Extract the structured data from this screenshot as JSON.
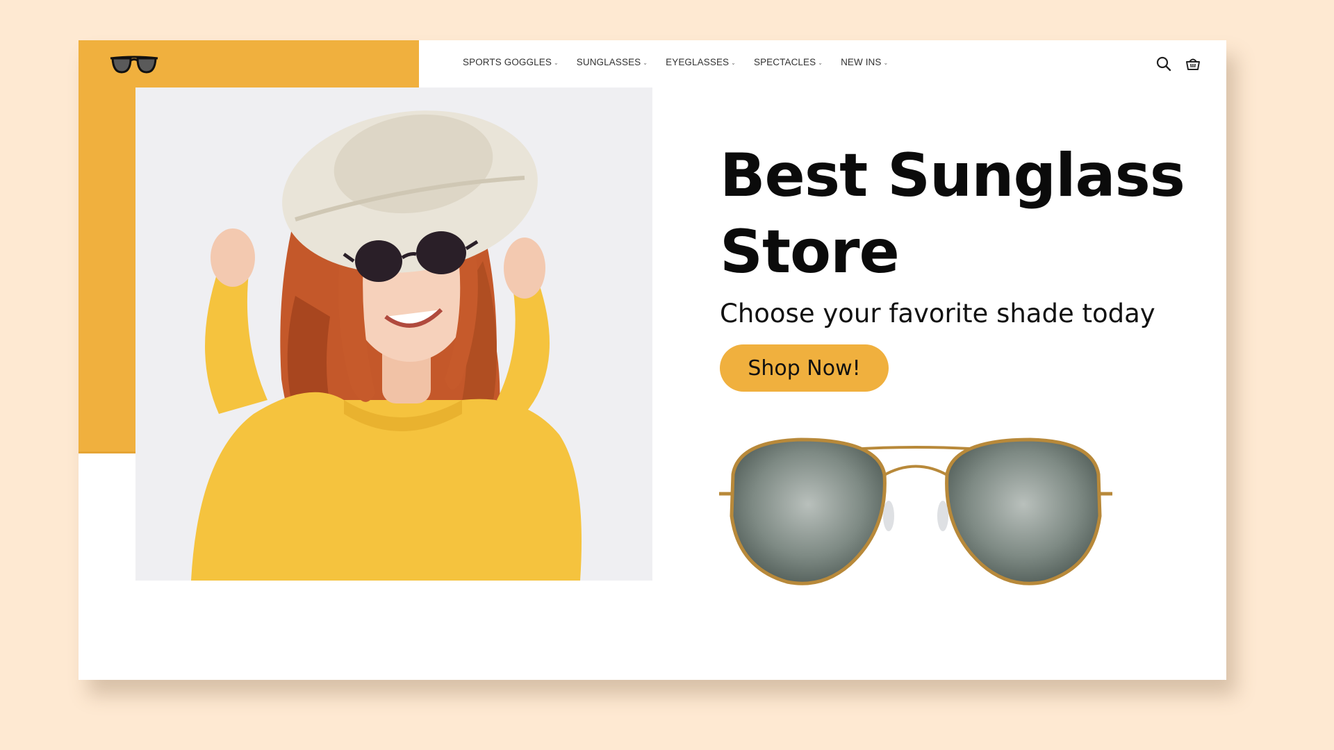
{
  "nav": {
    "items": [
      {
        "label": "SPORTS GOGGLES"
      },
      {
        "label": "SUNGLASSES"
      },
      {
        "label": "EYEGLASSES"
      },
      {
        "label": "SPECTACLES"
      },
      {
        "label": "NEW INS"
      }
    ],
    "caret": "⌄"
  },
  "hero": {
    "headline": "Best Sunglass Store",
    "subheadline": "Choose your favorite shade today",
    "cta_label": "Shop Now!"
  },
  "colors": {
    "page_bg": "#FEE9D2",
    "accent": "#F0B03E",
    "card_bg": "#FFFFFF",
    "text": "#0B0B0B"
  },
  "icons": [
    "sunglasses-logo-icon",
    "search-icon",
    "basket-icon",
    "chevron-down-icon"
  ]
}
